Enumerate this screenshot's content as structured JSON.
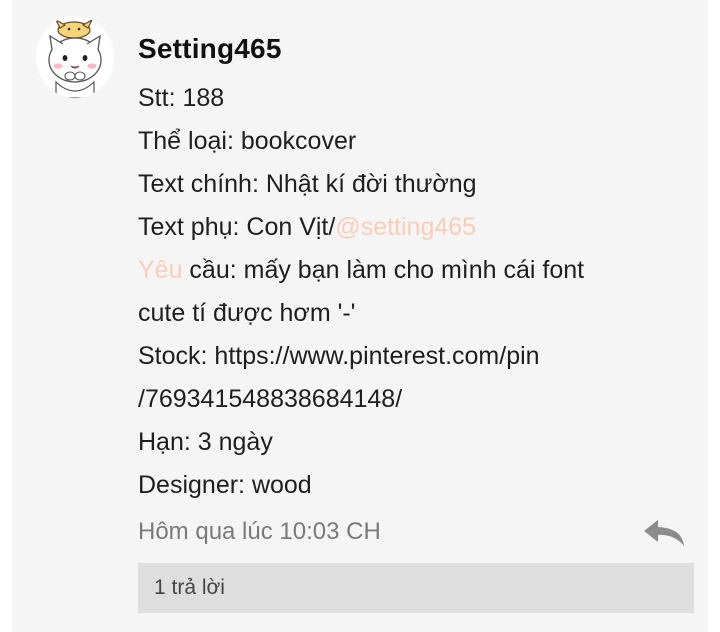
{
  "post": {
    "username": "Setting465",
    "lines": {
      "stt": "Stt: 188",
      "the_loai": "Thể loại: bookcover",
      "text_chinh": "Text chính: Nhật kí đời thường",
      "text_phu_prefix": "Text phụ: Con Vịt/",
      "text_phu_mention": "@setting465",
      "yeu_cau_faded": "Yêu",
      "yeu_cau_rest": " cầu: mấy bạn làm cho mình cái font",
      "yeu_cau_cont": "cute tí được hơm '-'",
      "stock_1": "Stock: https://www.pinterest.com/pin",
      "stock_2": "/769341548838684148/",
      "han": "Hạn: 3 ngày",
      "designer": "Designer: wood"
    },
    "timestamp": "Hôm qua lúc 10:03 CH",
    "replies_label": "1 trả lời",
    "reply_icon": "reply-arrow-icon",
    "avatar_icon": "cat-avatar"
  },
  "colors": {
    "card_background": "#f5f5f5",
    "mention": "#f9cdb8",
    "timestamp": "#7a7a7a",
    "replies_bar": "#dedede"
  }
}
